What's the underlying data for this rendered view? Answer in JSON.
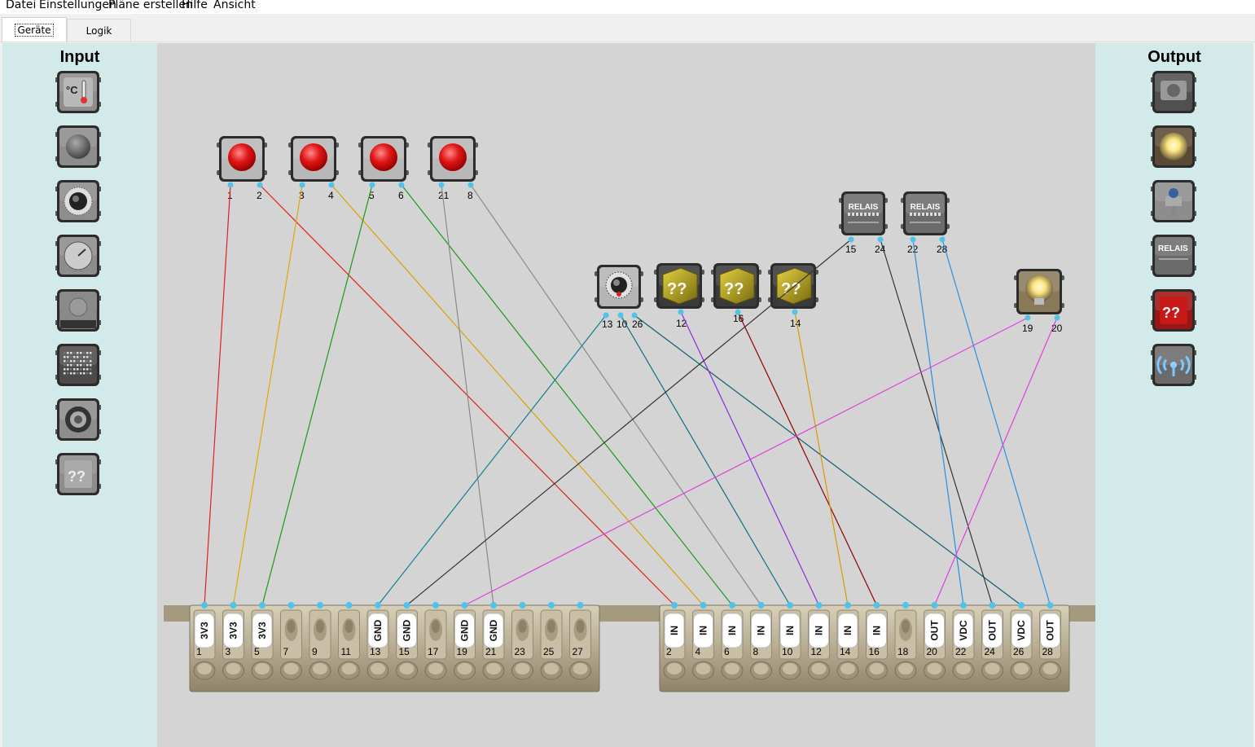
{
  "menu": [
    "Datei",
    "Einstellungen",
    "Pläne erstellen",
    "Hilfe",
    "Ansicht"
  ],
  "tabs": [
    "Geräte",
    "Logik"
  ],
  "left_panel": {
    "title": "Input",
    "items": [
      "thermometer-sensor",
      "push-button",
      "rotary-knob",
      "gauge-sensor",
      "stop-button",
      "matrix-display",
      "joystick",
      "unknown-input"
    ]
  },
  "right_panel": {
    "title": "Output",
    "items": [
      "motor",
      "lamp",
      "valve",
      "relay",
      "unknown-output",
      "wireless-antenna"
    ]
  },
  "canvas": {
    "buttons": [
      {
        "pins": [
          "1",
          "2"
        ]
      },
      {
        "pins": [
          "3",
          "4"
        ]
      },
      {
        "pins": [
          "5",
          "6"
        ]
      },
      {
        "pins": [
          "21",
          "8"
        ]
      }
    ],
    "knob": {
      "pins": [
        "13",
        "10",
        "26"
      ]
    },
    "mystery_blocks": [
      {
        "pin": "12",
        "symbol": "??"
      },
      {
        "pin": "16",
        "symbol": "??"
      },
      {
        "pin": "14",
        "symbol": "??"
      }
    ],
    "relays": [
      {
        "label": "RELAIS",
        "pins": [
          "15",
          "24"
        ]
      },
      {
        "label": "RELAIS",
        "pins": [
          "22",
          "28"
        ]
      }
    ],
    "lamp": {
      "pins": [
        "19",
        "20"
      ]
    },
    "terminal_left": [
      {
        "num": "1",
        "label": "3V3"
      },
      {
        "num": "3",
        "label": "3V3"
      },
      {
        "num": "5",
        "label": "3V3"
      },
      {
        "num": "7",
        "label": ""
      },
      {
        "num": "9",
        "label": ""
      },
      {
        "num": "11",
        "label": ""
      },
      {
        "num": "13",
        "label": "GND"
      },
      {
        "num": "15",
        "label": "GND"
      },
      {
        "num": "17",
        "label": ""
      },
      {
        "num": "19",
        "label": "GND"
      },
      {
        "num": "21",
        "label": "GND"
      },
      {
        "num": "23",
        "label": ""
      },
      {
        "num": "25",
        "label": ""
      },
      {
        "num": "27",
        "label": ""
      }
    ],
    "terminal_right": [
      {
        "num": "2",
        "label": "IN"
      },
      {
        "num": "4",
        "label": "IN"
      },
      {
        "num": "6",
        "label": "IN"
      },
      {
        "num": "8",
        "label": "IN"
      },
      {
        "num": "10",
        "label": "IN"
      },
      {
        "num": "12",
        "label": "IN"
      },
      {
        "num": "14",
        "label": "IN"
      },
      {
        "num": "16",
        "label": "IN"
      },
      {
        "num": "18",
        "label": ""
      },
      {
        "num": "20",
        "label": "OUT"
      },
      {
        "num": "22",
        "label": "VDC"
      },
      {
        "num": "24",
        "label": "OUT"
      },
      {
        "num": "26",
        "label": "VDC"
      },
      {
        "num": "28",
        "label": "OUT"
      }
    ]
  },
  "wires": [
    {
      "from": "button-1-pin-1",
      "to": "terminal-1",
      "color": "#e02020"
    },
    {
      "from": "button-1-pin-2",
      "to": "terminal-2",
      "color": "#e02020"
    },
    {
      "from": "button-2-pin-3",
      "to": "terminal-3",
      "color": "#e0a800"
    },
    {
      "from": "button-2-pin-4",
      "to": "terminal-4",
      "color": "#d9a100"
    },
    {
      "from": "button-3-pin-5",
      "to": "terminal-5",
      "color": "#1a9a1a"
    },
    {
      "from": "button-3-pin-6",
      "to": "terminal-6",
      "color": "#1a9a1a"
    },
    {
      "from": "button-4-pin-21",
      "to": "terminal-21",
      "color": "#8a8a8a"
    },
    {
      "from": "button-4-pin-8",
      "to": "terminal-8",
      "color": "#8a8a8a"
    },
    {
      "from": "knob-pin-13",
      "to": "terminal-13",
      "color": "#0e7f8f"
    },
    {
      "from": "knob-pin-10",
      "to": "terminal-10",
      "color": "#0e6f7f"
    },
    {
      "from": "knob-pin-26",
      "to": "terminal-26",
      "color": "#0e5f6f"
    },
    {
      "from": "block-1-pin-12",
      "to": "terminal-12",
      "color": "#8a2be2"
    },
    {
      "from": "block-2-pin-16",
      "to": "terminal-16",
      "color": "#8b0000"
    },
    {
      "from": "block-3-pin-14",
      "to": "terminal-14",
      "color": "#d99a00"
    },
    {
      "from": "relay-1-pin-15",
      "to": "terminal-15",
      "color": "#333333"
    },
    {
      "from": "relay-1-pin-24",
      "to": "terminal-24",
      "color": "#333333"
    },
    {
      "from": "relay-2-pin-22",
      "to": "terminal-22",
      "color": "#2a8fe0"
    },
    {
      "from": "relay-2-pin-28",
      "to": "terminal-28",
      "color": "#2a8fe0"
    },
    {
      "from": "lamp-pin-19",
      "to": "terminal-19",
      "color": "#e040e0"
    },
    {
      "from": "lamp-pin-20",
      "to": "terminal-20",
      "color": "#e040e0"
    }
  ]
}
